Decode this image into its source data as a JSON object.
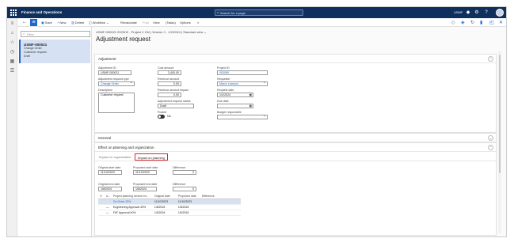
{
  "app": {
    "title": "Finance and Operations",
    "search_placeholder": "Search for a page",
    "company": "USMF",
    "header_icons": [
      "bell-icon",
      "gear-icon",
      "help-icon"
    ],
    "colors": {
      "topbar": "#0f2f5c",
      "accent": "#2266cc",
      "highlight": "#e0262a",
      "selected": "#d6e2f3"
    }
  },
  "actionbar": {
    "save": "Save",
    "new": "New",
    "delete": "Delete",
    "workflow": "Workflow",
    "recalculate": "Recalculate",
    "post": "Post",
    "view": "View",
    "tasks": "(Tasks)",
    "options": "Options"
  },
  "listpane": {
    "filter_placeholder": "Filter",
    "card": {
      "id": "USMF-000021",
      "line1": "Change Order",
      "line2": "Customer request",
      "line3": "Draft"
    }
  },
  "main": {
    "breadcrumb": "USMF-000021 2023H2 - Project 2 CM | Version 2 - 1/2/2024 | Standard view",
    "title": "Adjustment request"
  },
  "adjustment": {
    "header": "Adjustment",
    "adjustment_id_label": "Adjustment ID",
    "adjustment_id": "USMF-000021",
    "request_type_label": "Adjustment request type",
    "request_type": "Change Order",
    "description_label": "Description",
    "description": "Customer request",
    "cost_amount_label": "Cost amount",
    "cost_amount": "3,400.00",
    "revenue_amount_label": "Revenue amount",
    "revenue_amount": "0.00",
    "revenue_impact_label": "Revenue amount impact",
    "revenue_impact": "0.00",
    "status_label": "Adjustment request status",
    "status": "Draft",
    "posted_label": "Posted",
    "posted": "No",
    "project_id_label": "Project ID",
    "project_id": "000069",
    "requester_label": "Requester",
    "requester": "Marco Larsson",
    "request_date_label": "Request date",
    "request_date": "1/2/2024",
    "due_date_label": "Due date",
    "due_date": "",
    "budget_label": "Budget responsible",
    "budget": ""
  },
  "general": {
    "header": "General"
  },
  "effect": {
    "header": "Effect on planning and organization",
    "tab_org": "Impact on organization",
    "tab_planning": "Impact on planning",
    "orig_start_label": "Original start date",
    "orig_start": "11/10/2023",
    "prop_start_label": "Proposed start date",
    "prop_start": "11/10/2023",
    "diff1_label": "Difference",
    "diff1": "0",
    "orig_end_label": "Original end date",
    "orig_end": "1/8/2024",
    "prop_end_label": "Proposed end date",
    "prop_end": "1/8/2024",
    "diff2_label": "Difference",
    "diff2": "0",
    "grid": {
      "headers": [
        "d...",
        "Project planning service ev...",
        "Original date",
        "Proposed date",
        "Difference"
      ],
      "rows": [
        {
          "check": "",
          "marker": "",
          "name": "On Order 20%",
          "original": "11/10/2023",
          "proposed": "11/10/2023",
          "diff": ""
        },
        {
          "check": "",
          "marker": "—",
          "name": "Engineering Approval 40%",
          "original": "1/8/2024",
          "proposed": "1/8/2024",
          "diff": ""
        },
        {
          "check": "",
          "marker": "—",
          "name": "FAT Approval 40%",
          "original": "1/5/2024",
          "proposed": "1/5/2024",
          "diff": ""
        }
      ]
    }
  }
}
